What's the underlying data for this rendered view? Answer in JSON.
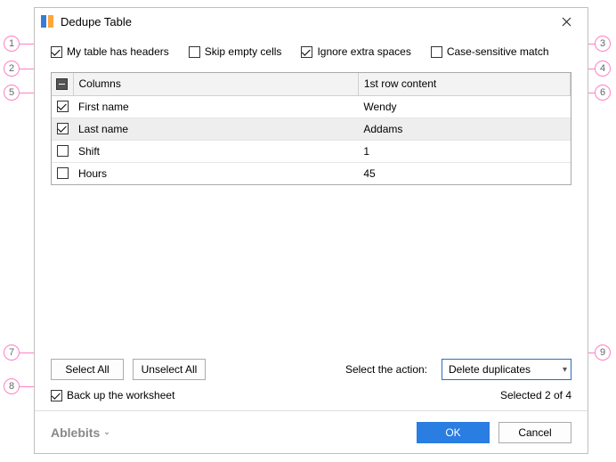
{
  "window": {
    "title": "Dedupe Table"
  },
  "options": {
    "headers": {
      "label": "My table has headers",
      "checked": true
    },
    "skip_empty": {
      "label": "Skip empty cells",
      "checked": false
    },
    "ignore_spaces": {
      "label": "Ignore extra spaces",
      "checked": true
    },
    "case_sensitive": {
      "label": "Case-sensitive match",
      "checked": false
    }
  },
  "table": {
    "header_col1": "Columns",
    "header_col2": "1st row content",
    "rows": [
      {
        "checked": true,
        "name": "First name",
        "sample": "Wendy",
        "selected": false
      },
      {
        "checked": true,
        "name": "Last name",
        "sample": "Addams",
        "selected": true
      },
      {
        "checked": false,
        "name": "Shift",
        "sample": "1",
        "selected": false
      },
      {
        "checked": false,
        "name": "Hours",
        "sample": "45",
        "selected": false
      }
    ]
  },
  "buttons": {
    "select_all": "Select All",
    "unselect_all": "Unselect All",
    "ok": "OK",
    "cancel": "Cancel"
  },
  "action": {
    "label": "Select the action:",
    "value": "Delete duplicates"
  },
  "backup": {
    "label": "Back up the worksheet",
    "checked": true
  },
  "status": {
    "selected": "Selected 2 of 4"
  },
  "brand": "Ablebits",
  "callouts": {
    "c1": "1",
    "c2": "2",
    "c3": "3",
    "c4": "4",
    "c5": "5",
    "c6": "6",
    "c7": "7",
    "c8": "8",
    "c9": "9"
  }
}
